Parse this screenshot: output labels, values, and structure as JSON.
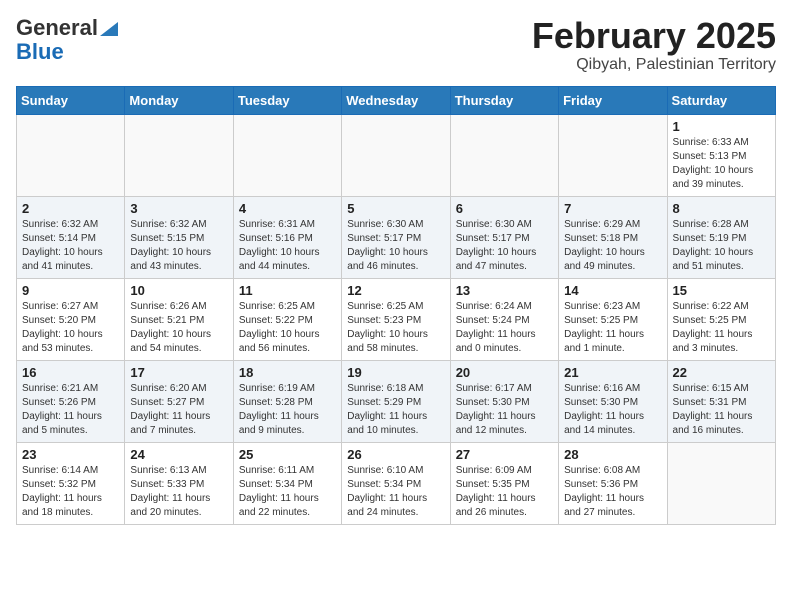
{
  "header": {
    "logo_general": "General",
    "logo_blue": "Blue",
    "title": "February 2025",
    "subtitle": "Qibyah, Palestinian Territory"
  },
  "weekdays": [
    "Sunday",
    "Monday",
    "Tuesday",
    "Wednesday",
    "Thursday",
    "Friday",
    "Saturday"
  ],
  "weeks": [
    [
      {
        "day": "",
        "info": ""
      },
      {
        "day": "",
        "info": ""
      },
      {
        "day": "",
        "info": ""
      },
      {
        "day": "",
        "info": ""
      },
      {
        "day": "",
        "info": ""
      },
      {
        "day": "",
        "info": ""
      },
      {
        "day": "1",
        "info": "Sunrise: 6:33 AM\nSunset: 5:13 PM\nDaylight: 10 hours\nand 39 minutes."
      }
    ],
    [
      {
        "day": "2",
        "info": "Sunrise: 6:32 AM\nSunset: 5:14 PM\nDaylight: 10 hours\nand 41 minutes."
      },
      {
        "day": "3",
        "info": "Sunrise: 6:32 AM\nSunset: 5:15 PM\nDaylight: 10 hours\nand 43 minutes."
      },
      {
        "day": "4",
        "info": "Sunrise: 6:31 AM\nSunset: 5:16 PM\nDaylight: 10 hours\nand 44 minutes."
      },
      {
        "day": "5",
        "info": "Sunrise: 6:30 AM\nSunset: 5:17 PM\nDaylight: 10 hours\nand 46 minutes."
      },
      {
        "day": "6",
        "info": "Sunrise: 6:30 AM\nSunset: 5:17 PM\nDaylight: 10 hours\nand 47 minutes."
      },
      {
        "day": "7",
        "info": "Sunrise: 6:29 AM\nSunset: 5:18 PM\nDaylight: 10 hours\nand 49 minutes."
      },
      {
        "day": "8",
        "info": "Sunrise: 6:28 AM\nSunset: 5:19 PM\nDaylight: 10 hours\nand 51 minutes."
      }
    ],
    [
      {
        "day": "9",
        "info": "Sunrise: 6:27 AM\nSunset: 5:20 PM\nDaylight: 10 hours\nand 53 minutes."
      },
      {
        "day": "10",
        "info": "Sunrise: 6:26 AM\nSunset: 5:21 PM\nDaylight: 10 hours\nand 54 minutes."
      },
      {
        "day": "11",
        "info": "Sunrise: 6:25 AM\nSunset: 5:22 PM\nDaylight: 10 hours\nand 56 minutes."
      },
      {
        "day": "12",
        "info": "Sunrise: 6:25 AM\nSunset: 5:23 PM\nDaylight: 10 hours\nand 58 minutes."
      },
      {
        "day": "13",
        "info": "Sunrise: 6:24 AM\nSunset: 5:24 PM\nDaylight: 11 hours\nand 0 minutes."
      },
      {
        "day": "14",
        "info": "Sunrise: 6:23 AM\nSunset: 5:25 PM\nDaylight: 11 hours\nand 1 minute."
      },
      {
        "day": "15",
        "info": "Sunrise: 6:22 AM\nSunset: 5:25 PM\nDaylight: 11 hours\nand 3 minutes."
      }
    ],
    [
      {
        "day": "16",
        "info": "Sunrise: 6:21 AM\nSunset: 5:26 PM\nDaylight: 11 hours\nand 5 minutes."
      },
      {
        "day": "17",
        "info": "Sunrise: 6:20 AM\nSunset: 5:27 PM\nDaylight: 11 hours\nand 7 minutes."
      },
      {
        "day": "18",
        "info": "Sunrise: 6:19 AM\nSunset: 5:28 PM\nDaylight: 11 hours\nand 9 minutes."
      },
      {
        "day": "19",
        "info": "Sunrise: 6:18 AM\nSunset: 5:29 PM\nDaylight: 11 hours\nand 10 minutes."
      },
      {
        "day": "20",
        "info": "Sunrise: 6:17 AM\nSunset: 5:30 PM\nDaylight: 11 hours\nand 12 minutes."
      },
      {
        "day": "21",
        "info": "Sunrise: 6:16 AM\nSunset: 5:30 PM\nDaylight: 11 hours\nand 14 minutes."
      },
      {
        "day": "22",
        "info": "Sunrise: 6:15 AM\nSunset: 5:31 PM\nDaylight: 11 hours\nand 16 minutes."
      }
    ],
    [
      {
        "day": "23",
        "info": "Sunrise: 6:14 AM\nSunset: 5:32 PM\nDaylight: 11 hours\nand 18 minutes."
      },
      {
        "day": "24",
        "info": "Sunrise: 6:13 AM\nSunset: 5:33 PM\nDaylight: 11 hours\nand 20 minutes."
      },
      {
        "day": "25",
        "info": "Sunrise: 6:11 AM\nSunset: 5:34 PM\nDaylight: 11 hours\nand 22 minutes."
      },
      {
        "day": "26",
        "info": "Sunrise: 6:10 AM\nSunset: 5:34 PM\nDaylight: 11 hours\nand 24 minutes."
      },
      {
        "day": "27",
        "info": "Sunrise: 6:09 AM\nSunset: 5:35 PM\nDaylight: 11 hours\nand 26 minutes."
      },
      {
        "day": "28",
        "info": "Sunrise: 6:08 AM\nSunset: 5:36 PM\nDaylight: 11 hours\nand 27 minutes."
      },
      {
        "day": "",
        "info": ""
      }
    ]
  ]
}
